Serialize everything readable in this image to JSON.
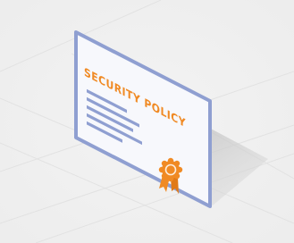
{
  "illustration": {
    "document": {
      "title": "SECURITY POLICY",
      "text_line_count": 5,
      "has_seal": true
    },
    "colors": {
      "background": "#f2f2f2",
      "grid_lines": "#e4e4e4",
      "document_fill": "#f7f8fc",
      "document_border": "#8f9fd1",
      "text_lines": "#8f9fd1",
      "title": "#f08a24",
      "seal": "#f08a24",
      "shadow": "#c9c9c9"
    }
  }
}
